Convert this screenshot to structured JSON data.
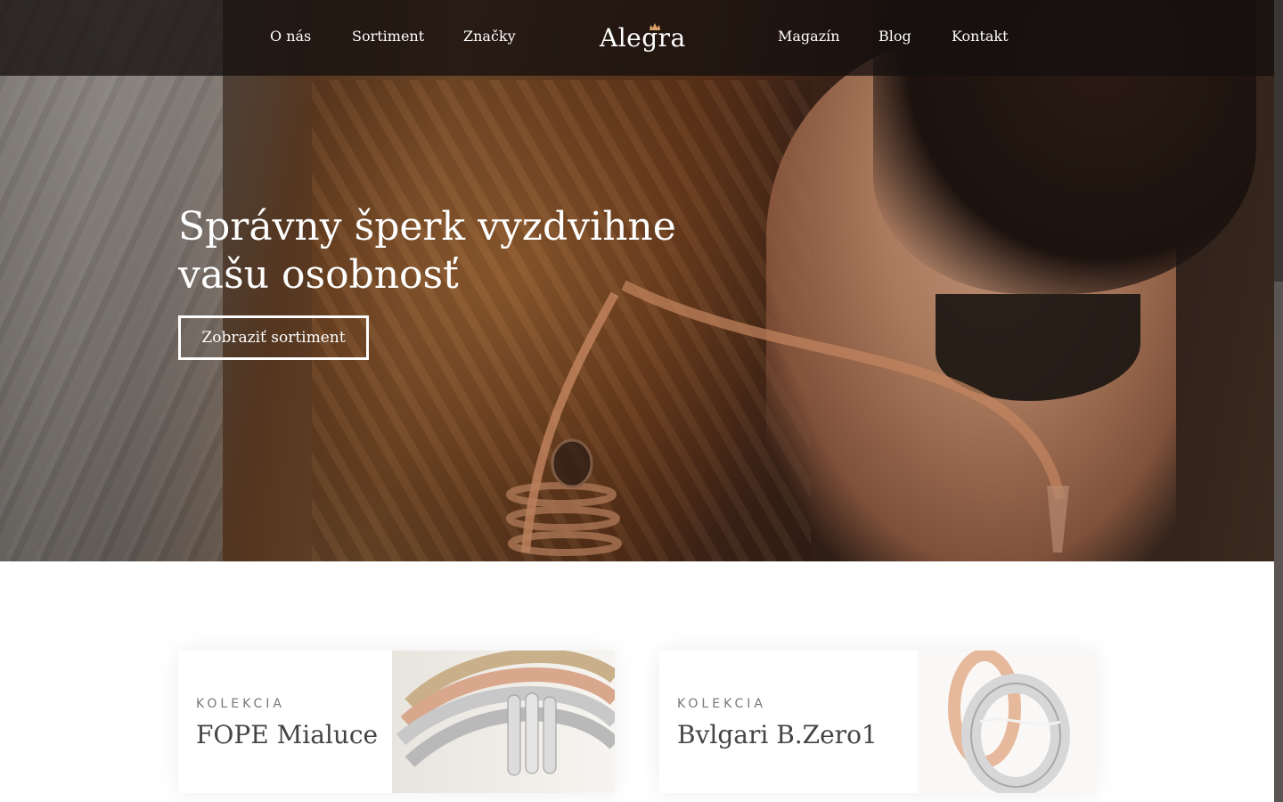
{
  "nav": {
    "left": [
      {
        "label": "O nás"
      },
      {
        "label": "Sortiment"
      },
      {
        "label": "Značky"
      }
    ],
    "logo_text": "Alegra",
    "right": [
      {
        "label": "Magazín"
      },
      {
        "label": "Blog"
      },
      {
        "label": "Kontakt"
      }
    ]
  },
  "hero": {
    "title_line1": "Správny šperk vyzdvihne",
    "title_line2": "vašu osobnosť",
    "cta_label": "Zobraziť sortiment"
  },
  "collections": [
    {
      "kicker": "KOLEKCIA",
      "title": "FOPE Mialuce"
    },
    {
      "kicker": "KOLEKCIA",
      "title": "Bvlgari B.Zero1"
    }
  ],
  "colors": {
    "accent_crown": "#d9a06a",
    "topbar": "#14100e",
    "text_light": "#ffffff"
  }
}
